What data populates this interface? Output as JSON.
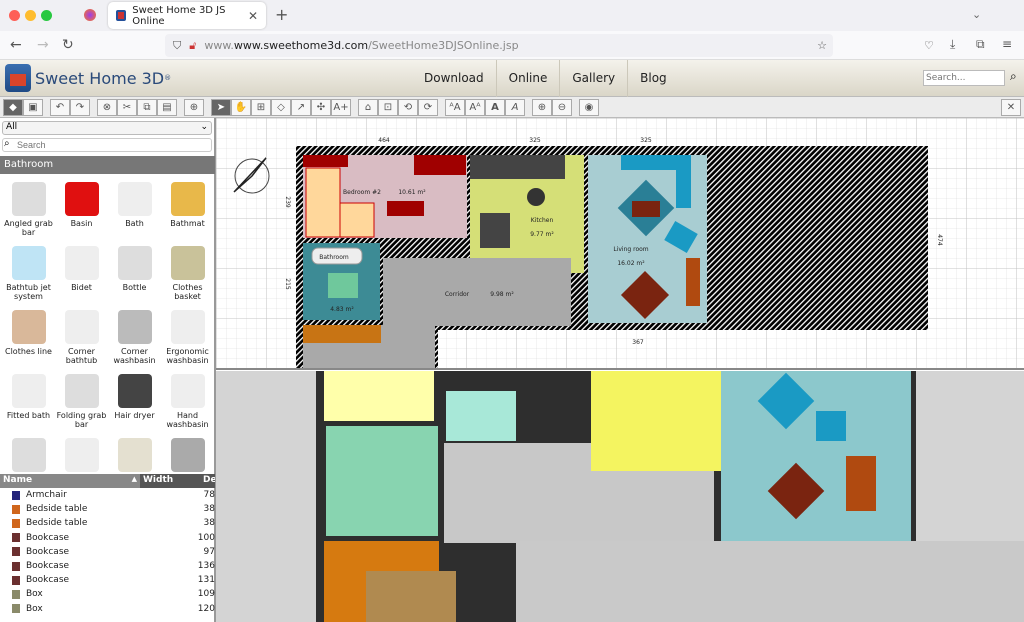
{
  "browser": {
    "tab_title": "Sweet Home 3D JS Online",
    "url_domain": "www.sweethome3d.com",
    "url_path": "/SweetHome3DJSOnline.jsp"
  },
  "site": {
    "logo": "Sweet Home 3D",
    "nav": [
      "Download",
      "Online",
      "Gallery",
      "Blog"
    ],
    "search_placeholder": "Search..."
  },
  "toolbar": {
    "icons": [
      "plan-view-icon",
      "3d-view-icon",
      "undo-icon",
      "redo-icon",
      "delete-icon",
      "cut-icon",
      "copy-icon",
      "paste-icon",
      "add-furniture-icon",
      "select-icon",
      "pan-icon",
      "create-walls-icon",
      "create-rooms-icon",
      "create-polylines-icon",
      "create-dimensions-icon",
      "add-text-icon",
      "import-icon",
      "modify-icon",
      "rotate-icon",
      "flip-icon",
      "text-size-increase-icon",
      "text-size-decrease-icon",
      "bold-icon",
      "italic-icon",
      "zoom-in-icon",
      "zoom-out-icon",
      "photo-icon",
      "preferences-icon"
    ]
  },
  "catalog": {
    "category_select": "All",
    "search_placeholder": "Search",
    "category": "Bathroom",
    "items": [
      "Angled grab bar",
      "Basin",
      "Bath",
      "Bathmat",
      "Bathtub jet system",
      "Bidet",
      "Bottle",
      "Clothes basket",
      "Clothes line",
      "Corner bathtub",
      "Corner washbasin",
      "Ergonomic washbasin",
      "Fitted bath",
      "Folding grab bar",
      "Hair dryer",
      "Hand washbasin",
      "",
      "",
      "",
      ""
    ],
    "colors": [
      "#ddd",
      "#e01010",
      "#eee",
      "#e8b84a",
      "#bfe4f5",
      "#eee",
      "#ddd",
      "#c9c29a",
      "#d9b89a",
      "#eee",
      "#bbb",
      "#eee",
      "#eee",
      "#ddd",
      "#444",
      "#eee",
      "#ddd",
      "#eee",
      "#e4e0d0",
      "#aaa"
    ]
  },
  "furniture_list": {
    "columns": [
      "Name",
      "Width",
      "Dep"
    ],
    "rows": [
      {
        "name": "Armchair",
        "width": "78",
        "color": "#23237a"
      },
      {
        "name": "Bedside table",
        "width": "38",
        "color": "#d0661c"
      },
      {
        "name": "Bedside table",
        "width": "38",
        "color": "#d0661c"
      },
      {
        "name": "Bookcase",
        "width": "100",
        "color": "#6b2f2f"
      },
      {
        "name": "Bookcase",
        "width": "97",
        "color": "#6b2f2f"
      },
      {
        "name": "Bookcase",
        "width": "136",
        "color": "#6b2f2f"
      },
      {
        "name": "Bookcase",
        "width": "131",
        "color": "#6b2f2f"
      },
      {
        "name": "Box",
        "width": "109",
        "color": "#8a8a6a"
      },
      {
        "name": "Box",
        "width": "120",
        "color": "#8a8a6a"
      }
    ]
  },
  "plan": {
    "dimensions": [
      "464",
      "325",
      "325",
      "239",
      "215",
      "474",
      "367"
    ],
    "rooms": [
      {
        "name": "Bedroom #2",
        "area": "10.61 m²",
        "color": "#d9bcc3"
      },
      {
        "name": "Kitchen",
        "area": "9.77 m²",
        "color": "#d5df77"
      },
      {
        "name": "Living room",
        "area": "16.02 m²",
        "color": "#a8cdd2"
      },
      {
        "name": "Bathroom",
        "area": "4.83 m²",
        "color": "#3d8b95"
      },
      {
        "name": "Corridor",
        "area": "9.98 m²",
        "color": "#a9a9a9"
      }
    ]
  }
}
